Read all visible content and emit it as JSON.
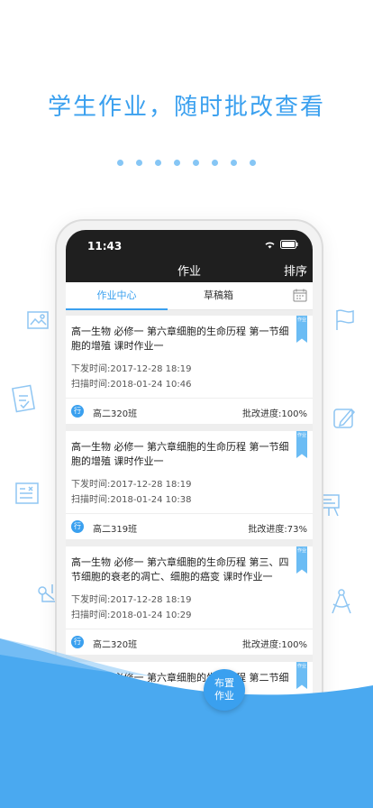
{
  "headline": "学生作业，随时批改查看",
  "phone": {
    "status_time": "11:43",
    "nav_title": "作业",
    "nav_action": "排序",
    "tabs": [
      "作业中心",
      "草稿箱"
    ],
    "bookmark_label": "作业",
    "assignments": [
      {
        "title": "高一生物 必修一 第六章细胞的生命历程 第一节细胞的增殖 课时作业一",
        "issued": "下发时间:2017-12-28 18:19",
        "scanned": "扫描时间:2018-01-24 10:46",
        "badge": "行",
        "class": "高二320班",
        "progress": "批改进度:100%"
      },
      {
        "title": "高一生物 必修一 第六章细胞的生命历程 第一节细胞的增殖 课时作业一",
        "issued": "下发时间:2017-12-28 18:19",
        "scanned": "扫描时间:2018-01-24 10:38",
        "badge": "行",
        "class": "高二319班",
        "progress": "批改进度:73%"
      },
      {
        "title": "高一生物 必修一 第六章细胞的生命历程 第三、四节细胞的衰老的凋亡、细胞的癌变 课时作业一",
        "issued": "下发时间:2017-12-28 18:19",
        "scanned": "扫描时间:2018-01-24 10:29",
        "badge": "行",
        "class": "高二320班",
        "progress": "批改进度:100%"
      },
      {
        "title": "高一生物 必修一 第六章细胞的生命历程 第二节细胞的",
        "issued": "",
        "scanned": "",
        "badge": "",
        "class": "",
        "progress": ""
      }
    ],
    "fab_label": "布置作业"
  },
  "colors": {
    "accent": "#3aa0ef",
    "bar": "#1f1f1f",
    "wave": "#4aa9f0"
  }
}
